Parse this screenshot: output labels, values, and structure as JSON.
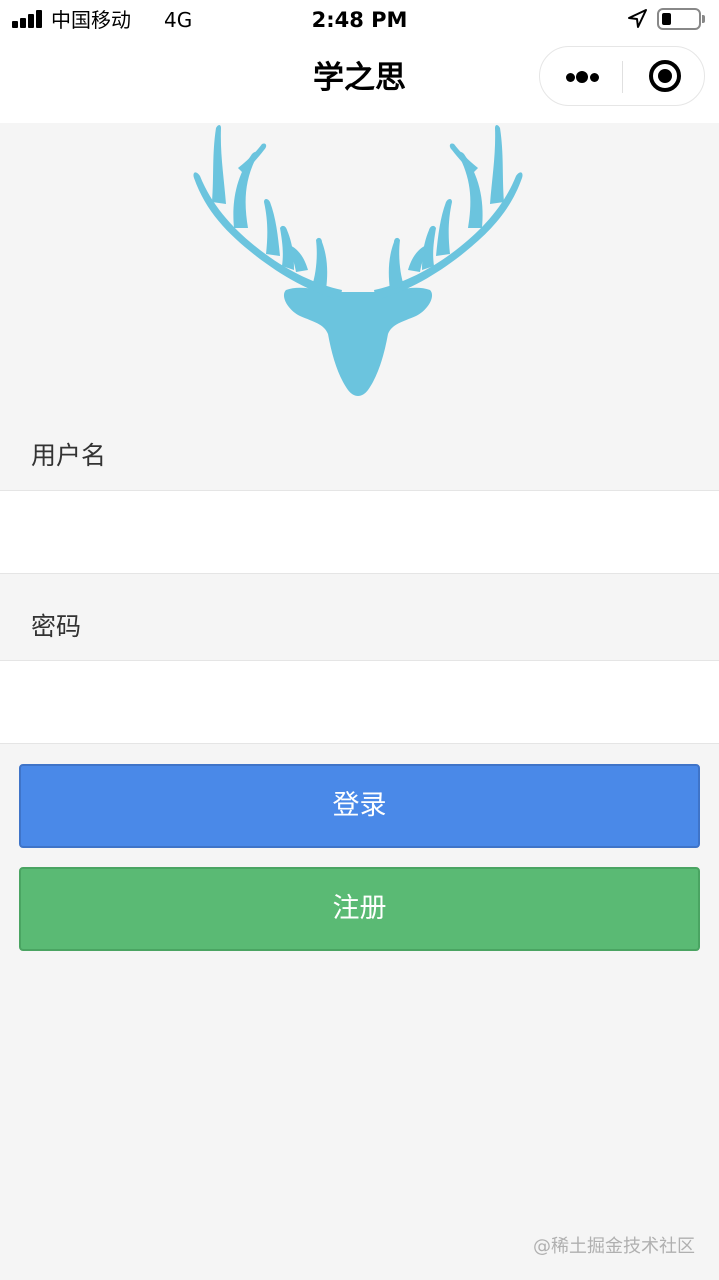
{
  "status_bar": {
    "carrier": "中国移动",
    "network": "4G",
    "time": "2:48 PM",
    "battery_level": 0.25
  },
  "nav": {
    "title": "学之思"
  },
  "logo": {
    "icon": "deer-antlers-icon",
    "color": "#6bc4de"
  },
  "form": {
    "username_label": "用户名",
    "username_value": "",
    "password_label": "密码",
    "password_value": ""
  },
  "buttons": {
    "login_label": "登录",
    "register_label": "注册"
  },
  "colors": {
    "login": "#4a89e8",
    "register": "#5aba74",
    "background": "#f5f5f5"
  },
  "watermark": "@稀土掘金技术社区"
}
